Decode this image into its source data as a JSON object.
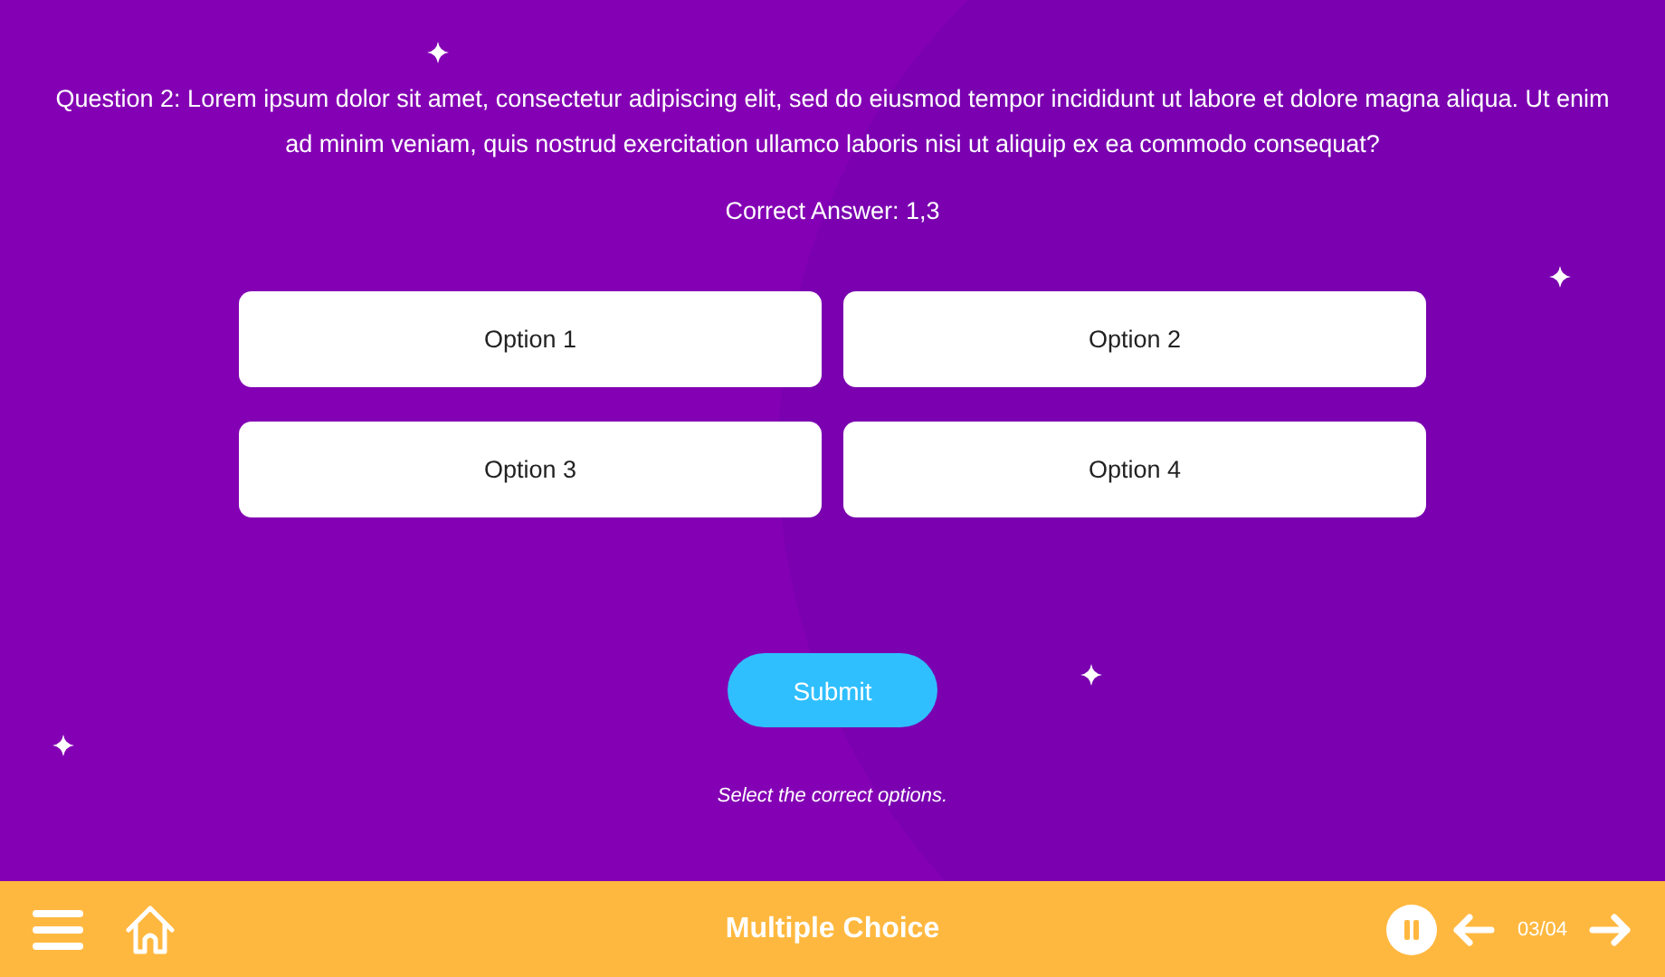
{
  "question": "Question 2: Lorem ipsum dolor sit amet, consectetur adipiscing elit, sed do eiusmod tempor incididunt ut labore et dolore magna aliqua. Ut enim ad minim veniam, quis nostrud exercitation ullamco laboris nisi ut aliquip ex ea commodo consequat?",
  "correct_answer": "Correct Answer: 1,3",
  "options": [
    {
      "label": "Option 1",
      "selected": false
    },
    {
      "label": "Option 2",
      "selected": false
    },
    {
      "label": "Option 3",
      "selected": false
    },
    {
      "label": "Option 4",
      "selected": false
    }
  ],
  "submit": "Submit",
  "instruction": "Select the correct options.",
  "footer": {
    "title": "Multiple Choice",
    "page": "03/04"
  }
}
